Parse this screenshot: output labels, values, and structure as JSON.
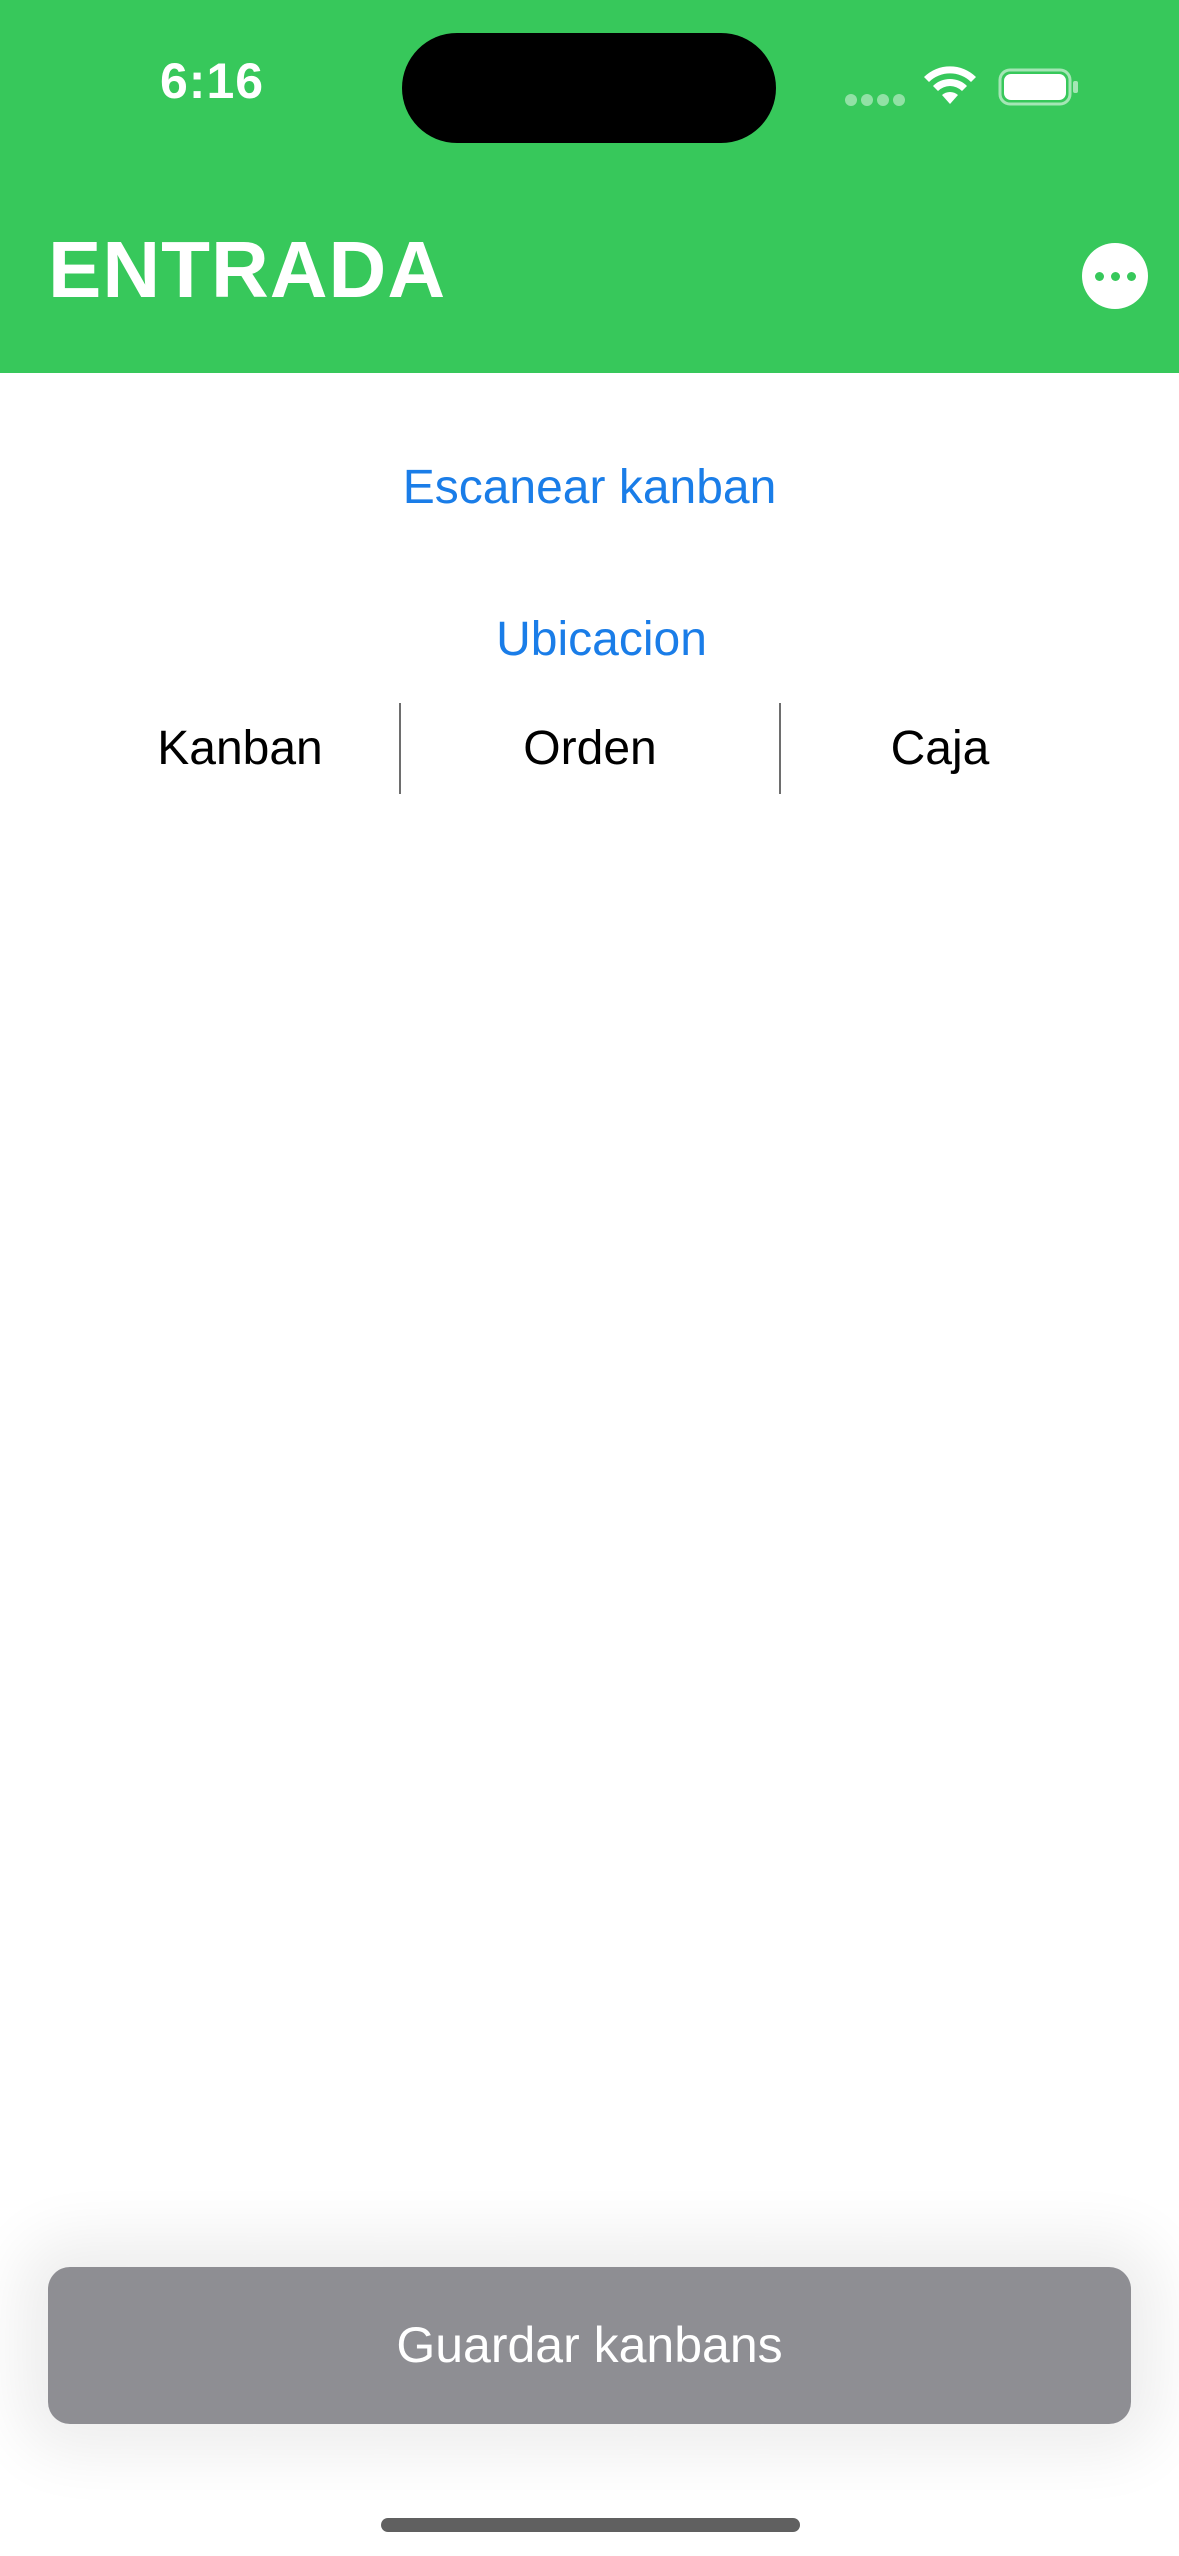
{
  "status_bar": {
    "time": "6:16"
  },
  "header": {
    "title": "ENTRADA",
    "more_icon": "ellipsis-circle-icon",
    "background_color": "#37c85b"
  },
  "actions": {
    "scan_label": "Escanear kanban",
    "location_label": "Ubicacion",
    "link_color": "#1a7de8"
  },
  "table": {
    "columns": [
      "Kanban",
      "Orden",
      "Caja"
    ]
  },
  "footer": {
    "save_label": "Guardar kanbans",
    "save_color": "#8e8e93"
  }
}
